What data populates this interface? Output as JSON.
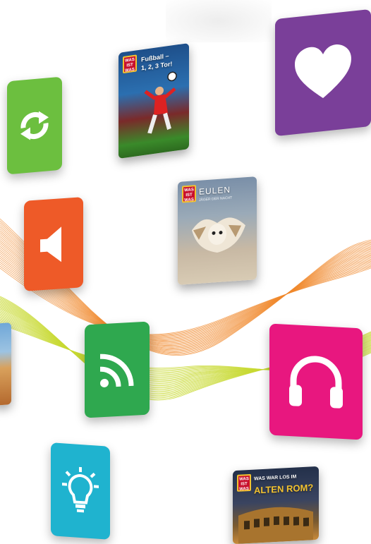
{
  "colors": {
    "green": "#6cbf3f",
    "orange": "#ee5a28",
    "purple": "#7a3f99",
    "pink": "#e8177f",
    "rss_green": "#2fa84f",
    "cyan": "#1fb3cf",
    "wave_orange": "#f08a2e",
    "wave_yellow": "#c8d933"
  },
  "tiles": [
    {
      "id": "sync",
      "icon": "refresh-icon"
    },
    {
      "id": "speaker",
      "icon": "speaker-icon"
    },
    {
      "id": "favorite",
      "icon": "heart-icon"
    },
    {
      "id": "rss",
      "icon": "rss-icon"
    },
    {
      "id": "headphones",
      "icon": "headphones-icon"
    },
    {
      "id": "idea",
      "icon": "lightbulb-icon"
    }
  ],
  "covers": {
    "fussball": {
      "badge": "WAS IST WAS",
      "title": "Fußball –\n1, 2, 3 Tor!"
    },
    "eulen": {
      "badge": "WAS IST WAS",
      "title": "EULEN",
      "subtitle": "JÄGER DER NACHT"
    },
    "rom": {
      "badge": "WAS IST WAS",
      "title_line1": "WAS WAR LOS IM",
      "title_line2": "ALTEN ROM?"
    }
  }
}
